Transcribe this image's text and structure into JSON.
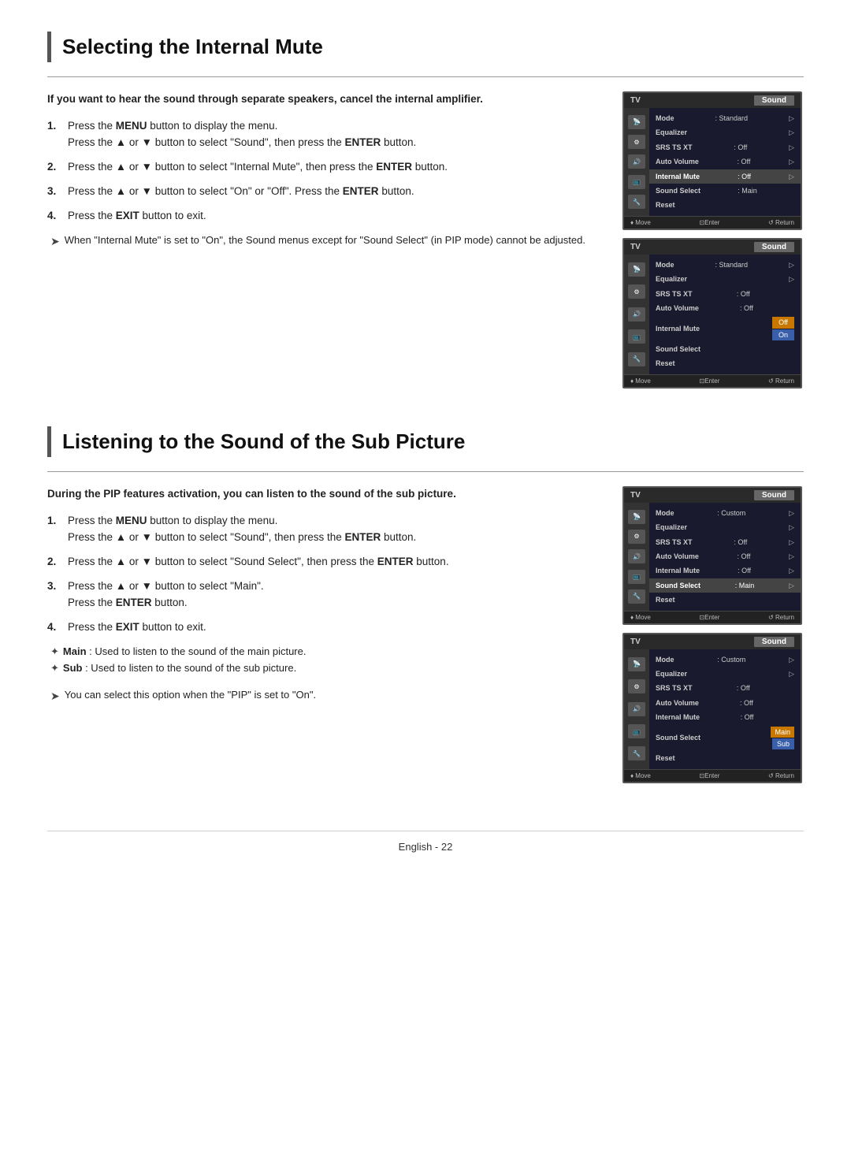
{
  "section1": {
    "title": "Selecting the Internal Mute",
    "intro": "If you want to hear the sound through separate speakers, cancel the internal amplifier.",
    "steps": [
      {
        "id": 1,
        "parts": [
          {
            "text": "Press the ",
            "plain": true
          },
          {
            "text": "MENU",
            "bold": true
          },
          {
            "text": " button to display the menu.",
            "plain": true
          },
          {
            "text": "Press the ▲ or ▼ button to select \"Sound\", then press the ",
            "newline": true,
            "plain": true
          },
          {
            "text": "ENTER",
            "bold": true
          },
          {
            "text": " button.",
            "plain": true
          }
        ],
        "text": "Press the MENU button to display the menu. Press the ▲ or ▼ button to select \"Sound\", then press the ENTER button."
      },
      {
        "id": 2,
        "text": "Press the ▲ or ▼ button to select \"Internal Mute\", then press the ENTER button."
      },
      {
        "id": 3,
        "text": "Press the ▲ or ▼ button to select \"On\" or \"Off\". Press the ENTER button."
      },
      {
        "id": 4,
        "text": "Press the EXIT button to exit."
      }
    ],
    "note": "When \"Internal Mute\" is set to \"On\", the Sound menus except for \"Sound Select\" (in PIP mode) cannot be adjusted.",
    "screen1": {
      "tv_label": "TV",
      "sound_label": "Sound",
      "rows": [
        {
          "label": "Mode",
          "value": ": Standard",
          "arrow": "▷"
        },
        {
          "label": "Equalizer",
          "value": "",
          "arrow": "▷"
        },
        {
          "label": "SRS TS XT",
          "value": ": Off",
          "arrow": "▷"
        },
        {
          "label": "Auto Volume",
          "value": ": Off",
          "arrow": "▷"
        },
        {
          "label": "Internal Mute",
          "value": ": Off",
          "arrow": "▷",
          "highlighted": true
        },
        {
          "label": "Sound Select",
          "value": ": Main",
          "arrow": ""
        },
        {
          "label": "Reset",
          "value": "",
          "arrow": ""
        }
      ],
      "footer": [
        "♦ Move",
        "⊡Enter",
        "↺ Return"
      ]
    },
    "screen2": {
      "tv_label": "TV",
      "sound_label": "Sound",
      "rows": [
        {
          "label": "Mode",
          "value": ": Standard",
          "arrow": "▷"
        },
        {
          "label": "Equalizer",
          "value": "",
          "arrow": "▷"
        },
        {
          "label": "SRS TS XT",
          "value": ": Off",
          "arrow": ""
        },
        {
          "label": "Auto Volume",
          "value": ": Off",
          "arrow": ""
        },
        {
          "label": "Internal Mute",
          "value": "Off",
          "arrow": "",
          "highlighted": true,
          "valueBox": true,
          "nextRow": "On"
        },
        {
          "label": "Sound Select",
          "value": "",
          "arrow": ""
        },
        {
          "label": "Reset",
          "value": "",
          "arrow": ""
        }
      ],
      "footer": [
        "♦ Move",
        "⊡Enter",
        "↺ Return"
      ]
    }
  },
  "section2": {
    "title": "Listening to the Sound of the Sub Picture",
    "intro": "During the PIP features activation, you can listen to the sound of the sub picture.",
    "steps": [
      {
        "id": 1,
        "text": "Press the MENU button to display the menu. Press the ▲ or ▼ button to select \"Sound\", then press the ENTER button."
      },
      {
        "id": 2,
        "text": "Press the ▲ or ▼ button to select \"Sound Select\", then press the ENTER button."
      },
      {
        "id": 3,
        "text": "Press the ▲ or ▼ button to select \"Main\". Press the ENTER button."
      },
      {
        "id": 4,
        "text": "Press the EXIT button to exit."
      }
    ],
    "bullets": [
      {
        "sym": "✦",
        "text": "Main : Used to listen to the sound of the main picture."
      },
      {
        "sym": "✦",
        "text": "Sub : Used to listen to the sound of the sub picture."
      }
    ],
    "note": "You can select this option when the \"PIP\" is set to \"On\".",
    "screen1": {
      "tv_label": "TV",
      "sound_label": "Sound",
      "rows": [
        {
          "label": "Mode",
          "value": ": Custom",
          "arrow": "▷"
        },
        {
          "label": "Equalizer",
          "value": "",
          "arrow": "▷"
        },
        {
          "label": "SRS TS XT",
          "value": ": Off",
          "arrow": "▷"
        },
        {
          "label": "Auto Volume",
          "value": ": Off",
          "arrow": "▷"
        },
        {
          "label": "Internal Mute",
          "value": ": Off",
          "arrow": "▷"
        },
        {
          "label": "Sound Select",
          "value": ": Main",
          "arrow": "▷",
          "highlighted": true
        },
        {
          "label": "Reset",
          "value": "",
          "arrow": ""
        }
      ],
      "footer": [
        "♦ Move",
        "⊡Enter",
        "↺ Return"
      ]
    },
    "screen2": {
      "tv_label": "TV",
      "sound_label": "Sound",
      "rows": [
        {
          "label": "Mode",
          "value": ": Custom",
          "arrow": "▷"
        },
        {
          "label": "Equalizer",
          "value": "",
          "arrow": "▷"
        },
        {
          "label": "SRS TS XT",
          "value": ": Off",
          "arrow": ""
        },
        {
          "label": "Auto Volume",
          "value": ": Off",
          "arrow": ""
        },
        {
          "label": "Internal Mute",
          "value": ": Off",
          "arrow": ""
        },
        {
          "label": "Sound Select",
          "value": "Main",
          "arrow": "",
          "highlighted": true,
          "valueBox": true,
          "nextRow": "Sub"
        },
        {
          "label": "Reset",
          "value": "",
          "arrow": ""
        }
      ],
      "footer": [
        "♦ Move",
        "⊡Enter",
        "↺ Return"
      ]
    }
  },
  "footer": {
    "text": "English - 22"
  }
}
